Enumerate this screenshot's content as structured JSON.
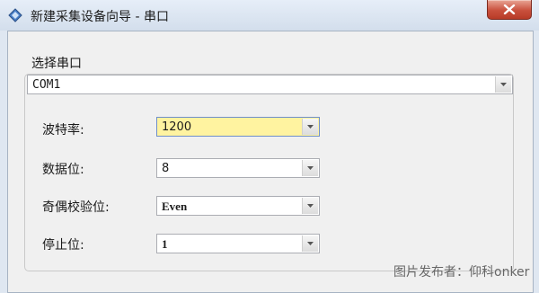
{
  "window": {
    "title": "新建采集设备向导 - 串口",
    "close_icon": "close-icon",
    "app_icon": "wizard-diamond-icon"
  },
  "port": {
    "label": "选择串口",
    "value": "COM1"
  },
  "settings": {
    "baud": {
      "label": "波特率:",
      "value": "1200"
    },
    "databits": {
      "label": "数据位:",
      "value": "8"
    },
    "parity": {
      "label": "奇偶校验位:",
      "value": "Even"
    },
    "stopbits": {
      "label": "停止位:",
      "value": "1"
    }
  },
  "watermark": "图片发布者：仰科onker",
  "colors": {
    "active_field": "#fff3a0",
    "close_button": "#c9503d"
  }
}
